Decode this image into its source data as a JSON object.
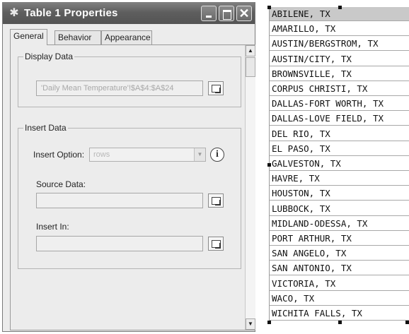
{
  "window": {
    "title": "Table 1 Properties",
    "tabs": [
      "General",
      "Behavior",
      "Appearance"
    ],
    "display_data": {
      "group_label": "Display Data",
      "field_value": "'Daily Mean Temperature'!$A$4:$A$24"
    },
    "insert_data": {
      "group_label": "Insert Data",
      "insert_option_label": "Insert Option:",
      "insert_option_value": "rows",
      "source_data_label": "Source Data:",
      "source_data_value": "",
      "insert_in_label": "Insert In:",
      "insert_in_value": ""
    }
  },
  "table": {
    "rows": [
      "ABILENE, TX",
      "AMARILLO, TX",
      "AUSTIN/BERGSTROM, TX",
      "AUSTIN/CITY, TX",
      "BROWNSVILLE, TX",
      "CORPUS CHRISTI, TX",
      "DALLAS-FORT WORTH, TX",
      "DALLAS-LOVE FIELD, TX",
      "DEL RIO, TX",
      "EL PASO, TX",
      "GALVESTON, TX",
      "HAVRE, TX",
      "HOUSTON, TX",
      "LUBBOCK, TX",
      "MIDLAND-ODESSA, TX",
      "PORT ARTHUR, TX",
      "SAN ANGELO, TX",
      "SAN ANTONIO, TX",
      "VICTORIA, TX",
      "WACO, TX",
      "WICHITA FALLS, TX"
    ],
    "selected_index": 0
  }
}
